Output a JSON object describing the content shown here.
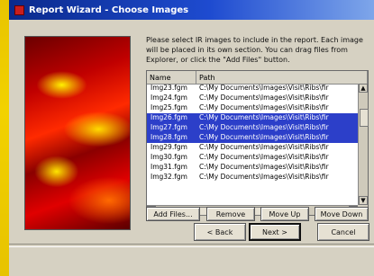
{
  "window": {
    "title": "Report Wizard - Choose Images"
  },
  "instructions": "Please select IR images to include in the report. Each image will be placed in its own section. You can drag files from Explorer, or click the \"Add Files\" button.",
  "list": {
    "columns": [
      "Name",
      "Path"
    ],
    "rows": [
      {
        "name": "Img23.fgm",
        "path": "C:\\My Documents\\Images\\Visit\\Ribs\\fir",
        "selected": false
      },
      {
        "name": "Img24.fgm",
        "path": "C:\\My Documents\\Images\\Visit\\Ribs\\fir",
        "selected": false
      },
      {
        "name": "Img25.fgm",
        "path": "C:\\My Documents\\Images\\Visit\\Ribs\\fir",
        "selected": false
      },
      {
        "name": "Img26.fgm",
        "path": "C:\\My Documents\\Images\\Visit\\Ribs\\fir",
        "selected": true
      },
      {
        "name": "Img27.fgm",
        "path": "C:\\My Documents\\Images\\Visit\\Ribs\\fir",
        "selected": true
      },
      {
        "name": "Img28.fgm",
        "path": "C:\\My Documents\\Images\\Visit\\Ribs\\fir",
        "selected": true
      },
      {
        "name": "Img29.fgm",
        "path": "C:\\My Documents\\Images\\Visit\\Ribs\\fir",
        "selected": false
      },
      {
        "name": "Img30.fgm",
        "path": "C:\\My Documents\\Images\\Visit\\Ribs\\fir",
        "selected": false
      },
      {
        "name": "Img31.fgm",
        "path": "C:\\My Documents\\Images\\Visit\\Ribs\\fir",
        "selected": false
      },
      {
        "name": "Img32.fgm",
        "path": "C:\\My Documents\\Images\\Visit\\Ribs\\fir",
        "selected": false
      }
    ]
  },
  "buttons": {
    "add_files": "Add Files...",
    "remove": "Remove",
    "move_up": "Move Up",
    "move_down": "Move Down",
    "back": "< Back",
    "next": "Next >",
    "cancel": "Cancel"
  },
  "icons": {
    "scroll_up": "scroll-up-arrow-icon",
    "scroll_down": "scroll-down-arrow-icon",
    "scroll_left": "scroll-left-arrow-icon",
    "scroll_right": "scroll-right-arrow-icon"
  },
  "colors": {
    "selection": "#2c3fc9",
    "titlebar_start": "#0a2a8c",
    "titlebar_end": "#7ea6ea"
  }
}
